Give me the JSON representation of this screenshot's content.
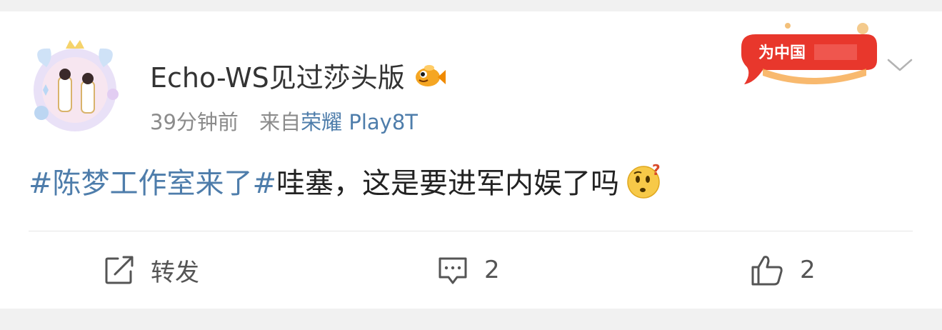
{
  "post": {
    "username": "Echo-WS见过莎头版",
    "time": "39分钟前",
    "source_prefix": "来自",
    "source_name": "荣耀 Play8T",
    "topic": "#陈梦工作室来了#",
    "text": "哇塞，这是要进军内娱了吗",
    "banner_text": "为中国"
  },
  "actions": {
    "repost_label": "转发",
    "comment_count": "2",
    "like_count": "2"
  },
  "icons": [
    "avatar",
    "fish-badge-icon",
    "banner-image",
    "chevron-down-icon",
    "thinking-face-icon",
    "repost-icon",
    "comment-icon",
    "thumbs-up-icon"
  ],
  "colors": {
    "link": "#4e7dab",
    "text": "#222222",
    "muted": "#8b8b8b",
    "background": "#f1f1f1"
  }
}
